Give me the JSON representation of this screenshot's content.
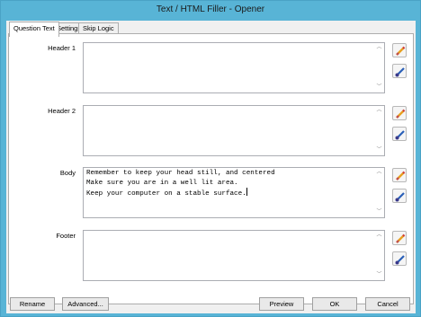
{
  "window": {
    "title": "Text / HTML Filler - Opener"
  },
  "tabs": [
    {
      "label": "Question Text",
      "active": true
    },
    {
      "label": "Settings",
      "active": false
    },
    {
      "label": "Skip Logic",
      "active": false
    }
  ],
  "fields": [
    {
      "label": "Header 1",
      "value": ""
    },
    {
      "label": "Header 2",
      "value": ""
    },
    {
      "label": "Body",
      "value": "Remember to keep your head still, and centered\nMake sure you are in a well lit area.\nKeep your computer on a stable surface."
    },
    {
      "label": "Footer",
      "value": ""
    }
  ],
  "icons": {
    "edit": "pencil-icon",
    "format": "brush-icon"
  },
  "buttons": {
    "rename": "Rename",
    "advanced": "Advanced...",
    "preview": "Preview",
    "ok": "OK",
    "cancel": "Cancel"
  },
  "colors": {
    "titlebar": "#58b4d6",
    "pencil": "#e8a020",
    "brush": "#2a5fb8"
  }
}
